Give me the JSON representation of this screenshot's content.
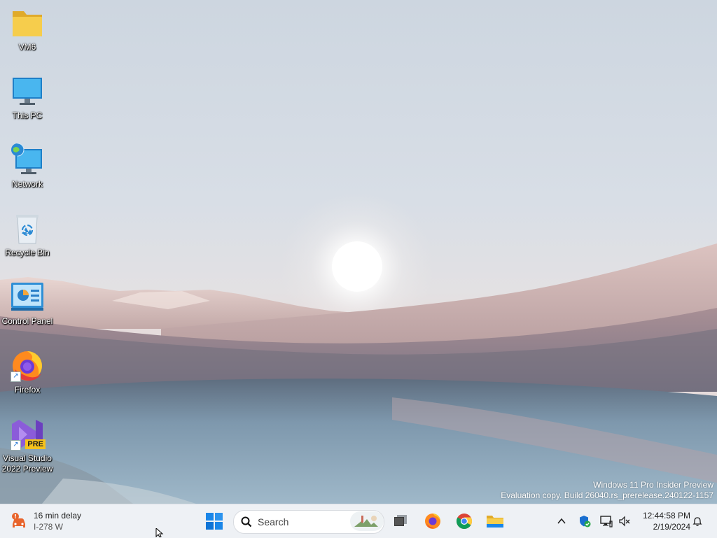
{
  "desktop": {
    "icons": [
      {
        "label": "VM6",
        "icon": "folder-icon"
      },
      {
        "label": "This PC",
        "icon": "computer-icon"
      },
      {
        "label": "Network",
        "icon": "network-icon"
      },
      {
        "label": "Recycle Bin",
        "icon": "recycle-bin-icon"
      },
      {
        "label": "Control Panel",
        "icon": "control-panel-icon"
      },
      {
        "label": "Firefox",
        "icon": "firefox-icon"
      },
      {
        "label": "Visual Studio\n2022 Preview",
        "icon": "visual-studio-icon",
        "badge": "PRE"
      }
    ]
  },
  "watermark": {
    "line1": "Windows 11 Pro Insider Preview",
    "line2": "Evaluation copy. Build 26040.rs_prerelease.240122-1157"
  },
  "taskbar": {
    "weather": {
      "line1": "16 min delay",
      "line2": "I-278 W",
      "icon": "traffic-alert-icon"
    },
    "start_icon": "windows-start-icon",
    "search_placeholder": "Search",
    "pinned": [
      "task-view-icon",
      "firefox-icon",
      "chrome-icon",
      "file-explorer-icon"
    ],
    "tray": [
      "chevron-up-icon",
      "windows-security-icon",
      "display-icon",
      "volume-muted-icon"
    ],
    "time": "12:44:58 PM",
    "date": "2/19/2024",
    "notification_icon": "bell-icon"
  },
  "colors": {
    "taskbar": "#eef1f5",
    "accent": "#0a64d8",
    "folder": "#f2c744"
  }
}
